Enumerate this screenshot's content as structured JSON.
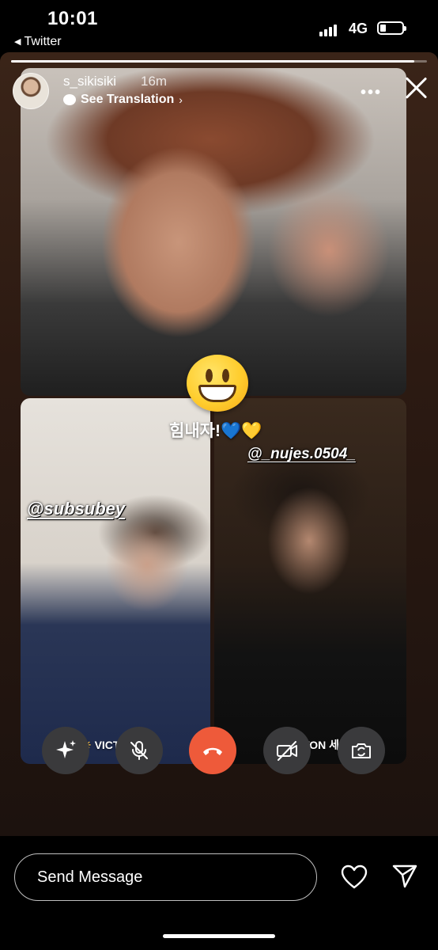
{
  "status_bar": {
    "time": "10:01",
    "back_app": "Twitter",
    "network": "4G",
    "signal_bars": 4,
    "battery_level": 0.25
  },
  "story": {
    "progress": 0.97,
    "username": "s_sikisiki",
    "time_ago": "16m",
    "see_translation": "See Translation",
    "more_icon": "more-icon",
    "close_icon": "close-icon"
  },
  "stickers": {
    "emoji": "grinning-face",
    "cheer_text": "힘내자!",
    "cheer_hearts": [
      "💙",
      "💛"
    ],
    "mention_left": "@subsubey",
    "mention_right": "@_nujes.0504_"
  },
  "call": {
    "tiles": [
      {
        "name": "top",
        "label": ""
      },
      {
        "name": "left",
        "label": "VICTON 숩"
      },
      {
        "name": "right",
        "label": "VICTON 세준"
      }
    ],
    "controls": [
      "effects-icon",
      "mic-muted-icon",
      "end-call-icon",
      "camera-off-icon",
      "flip-camera-icon"
    ],
    "colors": {
      "end_call": "#ee5a3a",
      "control_bg": "#3a3a3c"
    }
  },
  "bottom_bar": {
    "send_placeholder": "Send Message",
    "heart_icon": "heart-icon",
    "share_icon": "share-icon"
  }
}
